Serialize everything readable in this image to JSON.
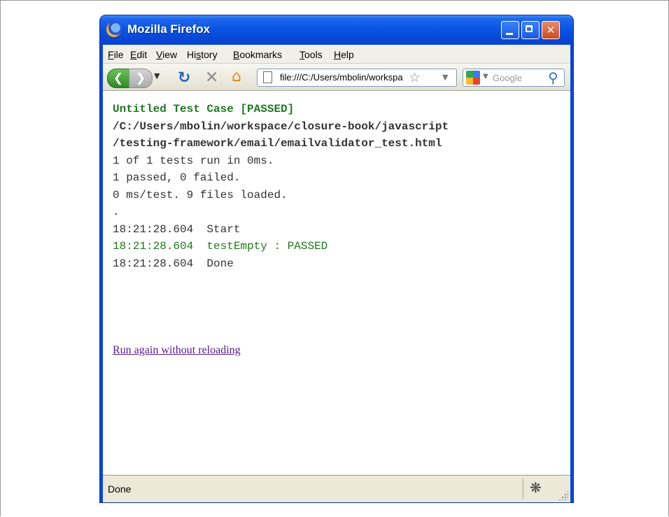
{
  "window": {
    "title": "Mozilla Firefox"
  },
  "menubar": {
    "items": [
      {
        "label": "File",
        "mnemonic": "F",
        "rest": "ile"
      },
      {
        "label": "Edit",
        "mnemonic": "E",
        "rest": "dit"
      },
      {
        "label": "View",
        "mnemonic": "V",
        "rest": "iew"
      },
      {
        "label": "History",
        "pre": "Hi",
        "mnemonic": "s",
        "rest": "tory"
      },
      {
        "label": "Bookmarks",
        "mnemonic": "B",
        "rest": "ookmarks"
      },
      {
        "label": "Tools",
        "mnemonic": "T",
        "rest": "ools"
      },
      {
        "label": "Help",
        "mnemonic": "H",
        "rest": "elp"
      }
    ]
  },
  "navbar": {
    "url": "file:///C:/Users/mbolin/workspace/closure-book/javascript/testing-framework/email/emailvalidator_test.html",
    "search_placeholder": "Google"
  },
  "content": {
    "heading": "Untitled Test Case [PASSED]",
    "path_line1": "/C:/Users/mbolin/workspace/closure-book/javascript",
    "path_line2": "/testing-framework/email/emailvalidator_test.html",
    "summary1": "1 of 1 tests run in 0ms.",
    "summary2": "1 passed, 0 failed.",
    "summary3": "0 ms/test. 9 files loaded.",
    "dot": ".",
    "log": [
      {
        "time": "18:21:28.604",
        "msg": "Start",
        "status": "info"
      },
      {
        "time": "18:21:28.604",
        "msg": "testEmpty : PASSED",
        "status": "pass"
      },
      {
        "time": "18:21:28.604",
        "msg": "Done",
        "status": "info"
      }
    ],
    "rerun_link": "Run again without reloading"
  },
  "statusbar": {
    "text": "Done"
  },
  "colors": {
    "pass_green": "#207820",
    "visited_link": "#551a8b",
    "titlebar_blue": "#0a55e3"
  }
}
